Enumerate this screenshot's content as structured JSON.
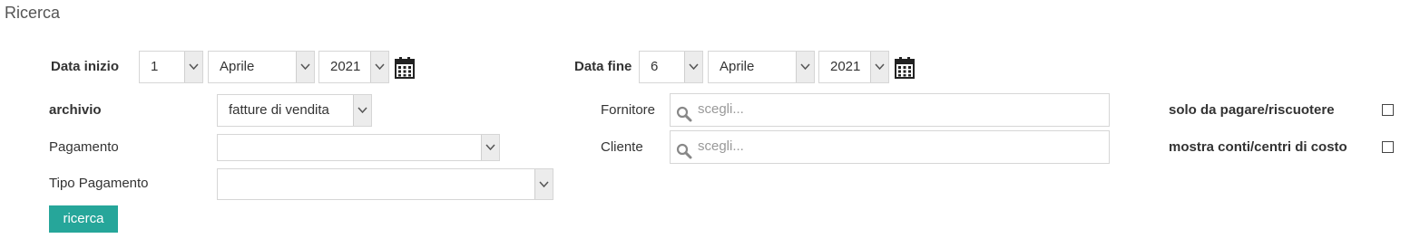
{
  "title": "Ricerca",
  "data_inizio": {
    "label": "Data inizio",
    "day": "1",
    "month": "Aprile",
    "year": "2021"
  },
  "data_fine": {
    "label": "Data fine",
    "day": "6",
    "month": "Aprile",
    "year": "2021"
  },
  "archivio": {
    "label": "archivio",
    "value": "fatture di vendita"
  },
  "pagamento": {
    "label": "Pagamento",
    "value": ""
  },
  "tipo_pagamento": {
    "label": "Tipo Pagamento",
    "value": ""
  },
  "fornitore": {
    "label": "Fornitore",
    "placeholder": "scegli..."
  },
  "cliente": {
    "label": "Cliente",
    "placeholder": "scegli..."
  },
  "options": {
    "solo_da_pagare": {
      "label": "solo da pagare/riscuotere",
      "checked": false
    },
    "mostra_conti": {
      "label": "mostra conti/centri di costo",
      "checked": false
    }
  },
  "search_button": {
    "label": "ricerca"
  },
  "colors": {
    "accent": "#26a69a",
    "border": "#d6d6d6",
    "arrow_bg": "#ececec"
  },
  "icons": [
    "calendar-icon",
    "chevron-down-icon",
    "search-icon"
  ]
}
